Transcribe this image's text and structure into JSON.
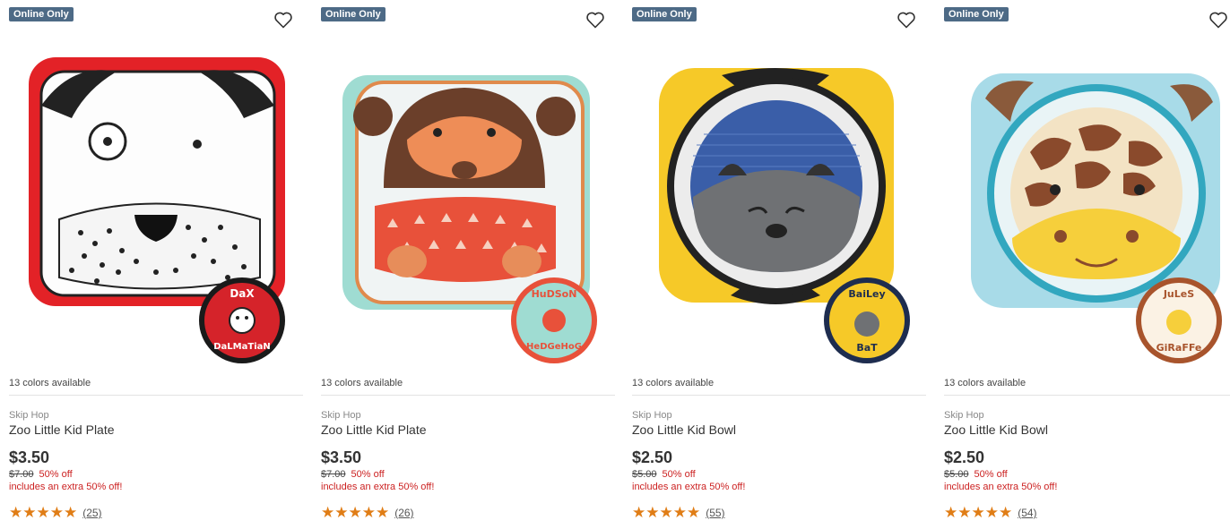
{
  "products": [
    {
      "badge": "Online Only",
      "colors": "13 colors available",
      "brand": "Skip Hop",
      "title": "Zoo Little Kid Plate",
      "price": "$3.50",
      "original_price": "$7.00",
      "discount": "50% off",
      "extra": "includes an extra 50% off!",
      "stars": "★★★★★",
      "rating": 5,
      "review_count": "(25)",
      "image_icon": "dalmatian-plate-image",
      "sticker_lines": [
        "DaX",
        "DaLMaTiaN"
      ]
    },
    {
      "badge": "Online Only",
      "colors": "13 colors available",
      "brand": "Skip Hop",
      "title": "Zoo Little Kid Plate",
      "price": "$3.50",
      "original_price": "$7.00",
      "discount": "50% off",
      "extra": "includes an extra 50% off!",
      "stars": "★★★★★",
      "rating": 5,
      "review_count": "(26)",
      "image_icon": "hedgehog-plate-image",
      "sticker_lines": [
        "HuDSoN",
        "HeDGeHoG"
      ]
    },
    {
      "badge": "Online Only",
      "colors": "13 colors available",
      "brand": "Skip Hop",
      "title": "Zoo Little Kid Bowl",
      "price": "$2.50",
      "original_price": "$5.00",
      "discount": "50% off",
      "extra": "includes an extra 50% off!",
      "stars": "★★★★★",
      "rating": 5,
      "review_count": "(55)",
      "image_icon": "bat-bowl-image",
      "sticker_lines": [
        "BaiLey",
        "BaT"
      ]
    },
    {
      "badge": "Online Only",
      "colors": "13 colors available",
      "brand": "Skip Hop",
      "title": "Zoo Little Kid Bowl",
      "price": "$2.50",
      "original_price": "$5.00",
      "discount": "50% off",
      "extra": "includes an extra 50% off!",
      "stars": "★★★★★",
      "rating": 5,
      "review_count": "(54)",
      "image_icon": "giraffe-bowl-image",
      "sticker_lines": [
        "JuLeS",
        "GiRaFFe"
      ]
    }
  ],
  "icons": {
    "wishlist": "heart-outline-icon",
    "star": "star-icon"
  },
  "colors": {
    "badge": "#4d6a86",
    "sale": "#cc2222",
    "star": "#e07d16"
  }
}
